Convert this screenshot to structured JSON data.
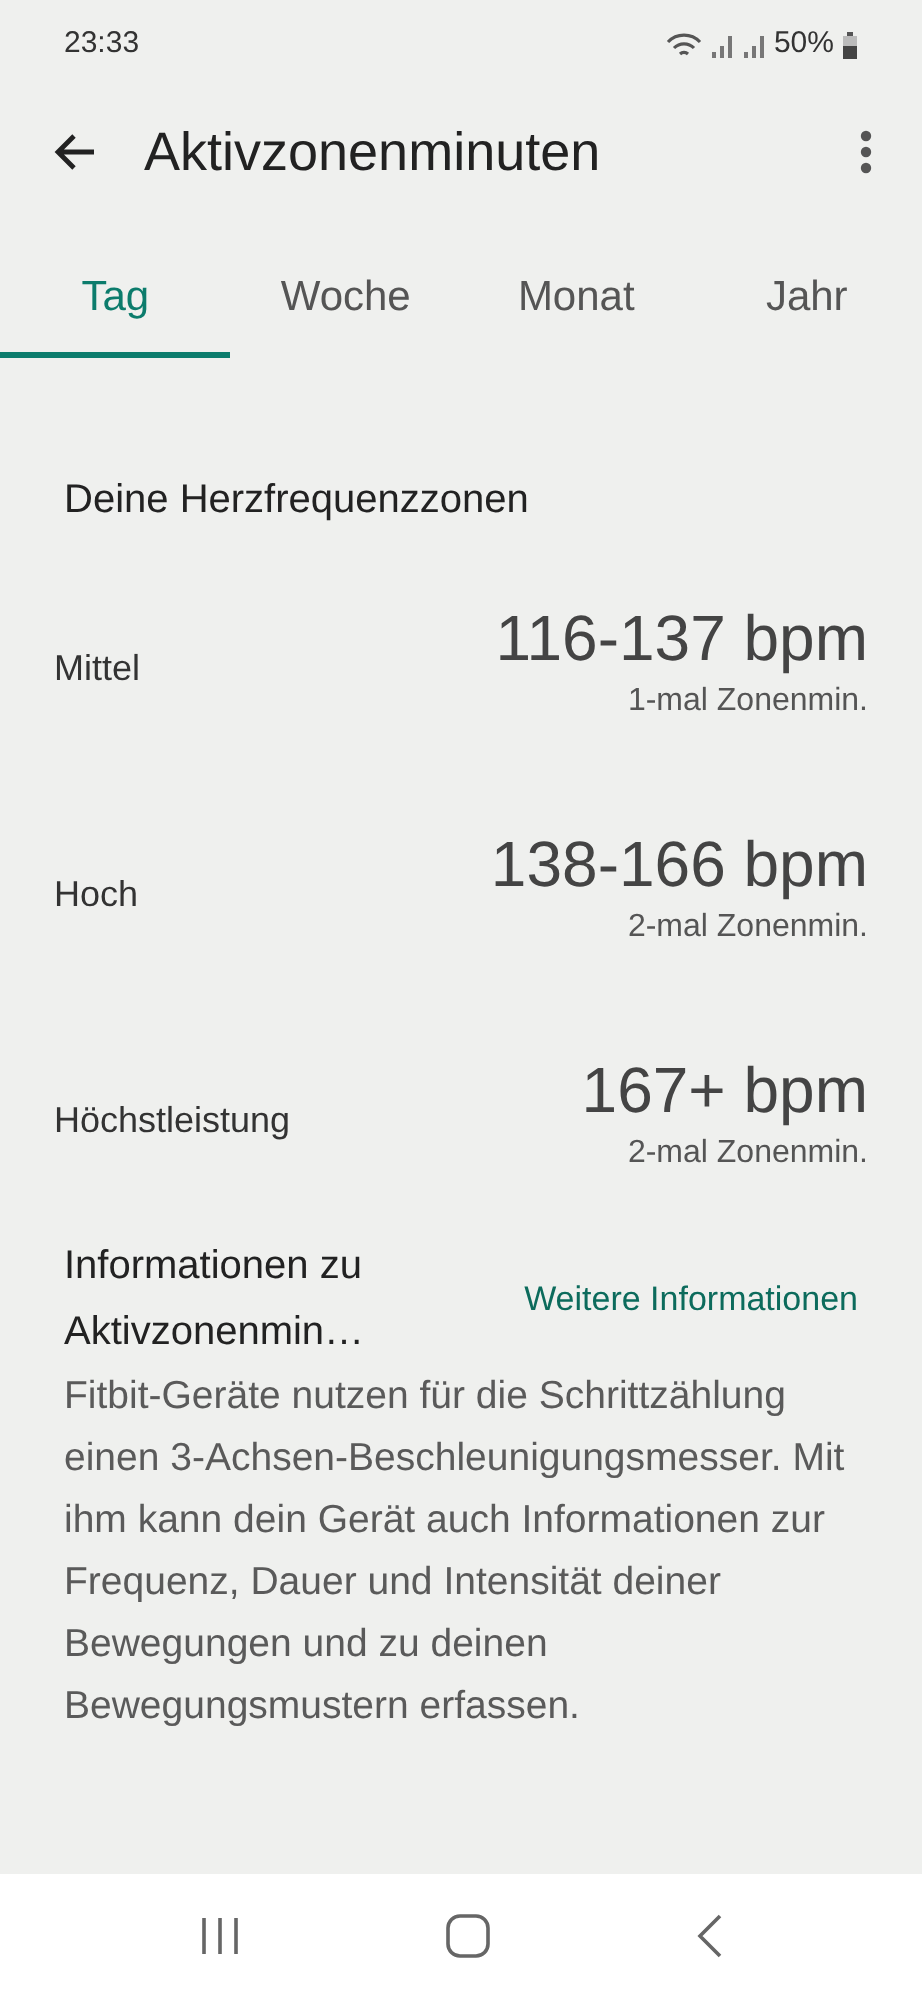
{
  "status_bar": {
    "time": "23:33",
    "battery": "50%"
  },
  "toolbar": {
    "title": "Aktivzonenminuten"
  },
  "tabs": [
    {
      "label": "Tag",
      "selected": true
    },
    {
      "label": "Woche",
      "selected": false
    },
    {
      "label": "Monat",
      "selected": false
    },
    {
      "label": "Jahr",
      "selected": false
    }
  ],
  "zones_section": {
    "title": "Deine Herzfrequenzzonen",
    "zones": [
      {
        "name": "Mittel",
        "range": "116-137 bpm",
        "note": "1-mal Zonenmin."
      },
      {
        "name": "Hoch",
        "range": "138-166 bpm",
        "note": "2-mal Zonenmin."
      },
      {
        "name": "Höchstleistung",
        "range": "167+ bpm",
        "note": "2-mal Zonenmin."
      }
    ]
  },
  "info": {
    "title": "Informationen zu Aktivzonenmin…",
    "link": "Weitere Informationen",
    "text": "Fitbit-Geräte nutzen für die Schrittzählung einen 3-Achsen-Beschleunigungsmesser. Mit ihm kann dein Gerät auch Informationen zur Frequenz, Dauer und Intensität deiner Bewegungen und zu deinen Bewegungsmustern erfassen."
  }
}
